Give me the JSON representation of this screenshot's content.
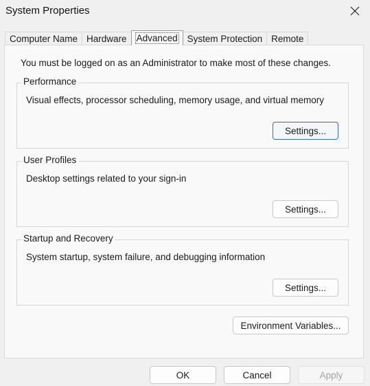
{
  "window": {
    "title": "System Properties"
  },
  "tabs": [
    {
      "label": "Computer Name",
      "active": false
    },
    {
      "label": "Hardware",
      "active": false
    },
    {
      "label": "Advanced",
      "active": true
    },
    {
      "label": "System Protection",
      "active": false
    },
    {
      "label": "Remote",
      "active": false
    }
  ],
  "advanced": {
    "admin_note": "You must be logged on as an Administrator to make most of these changes.",
    "performance": {
      "label": "Performance",
      "description": "Visual effects, processor scheduling, memory usage, and virtual memory",
      "settings_label": "Settings..."
    },
    "user_profiles": {
      "label": "User Profiles",
      "description": "Desktop settings related to your sign-in",
      "settings_label": "Settings..."
    },
    "startup_recovery": {
      "label": "Startup and Recovery",
      "description": "System startup, system failure, and debugging information",
      "settings_label": "Settings..."
    },
    "env_vars_label": "Environment Variables..."
  },
  "footer": {
    "ok_label": "OK",
    "cancel_label": "Cancel",
    "apply_label": "Apply"
  },
  "icons": {
    "close": "close-icon"
  }
}
